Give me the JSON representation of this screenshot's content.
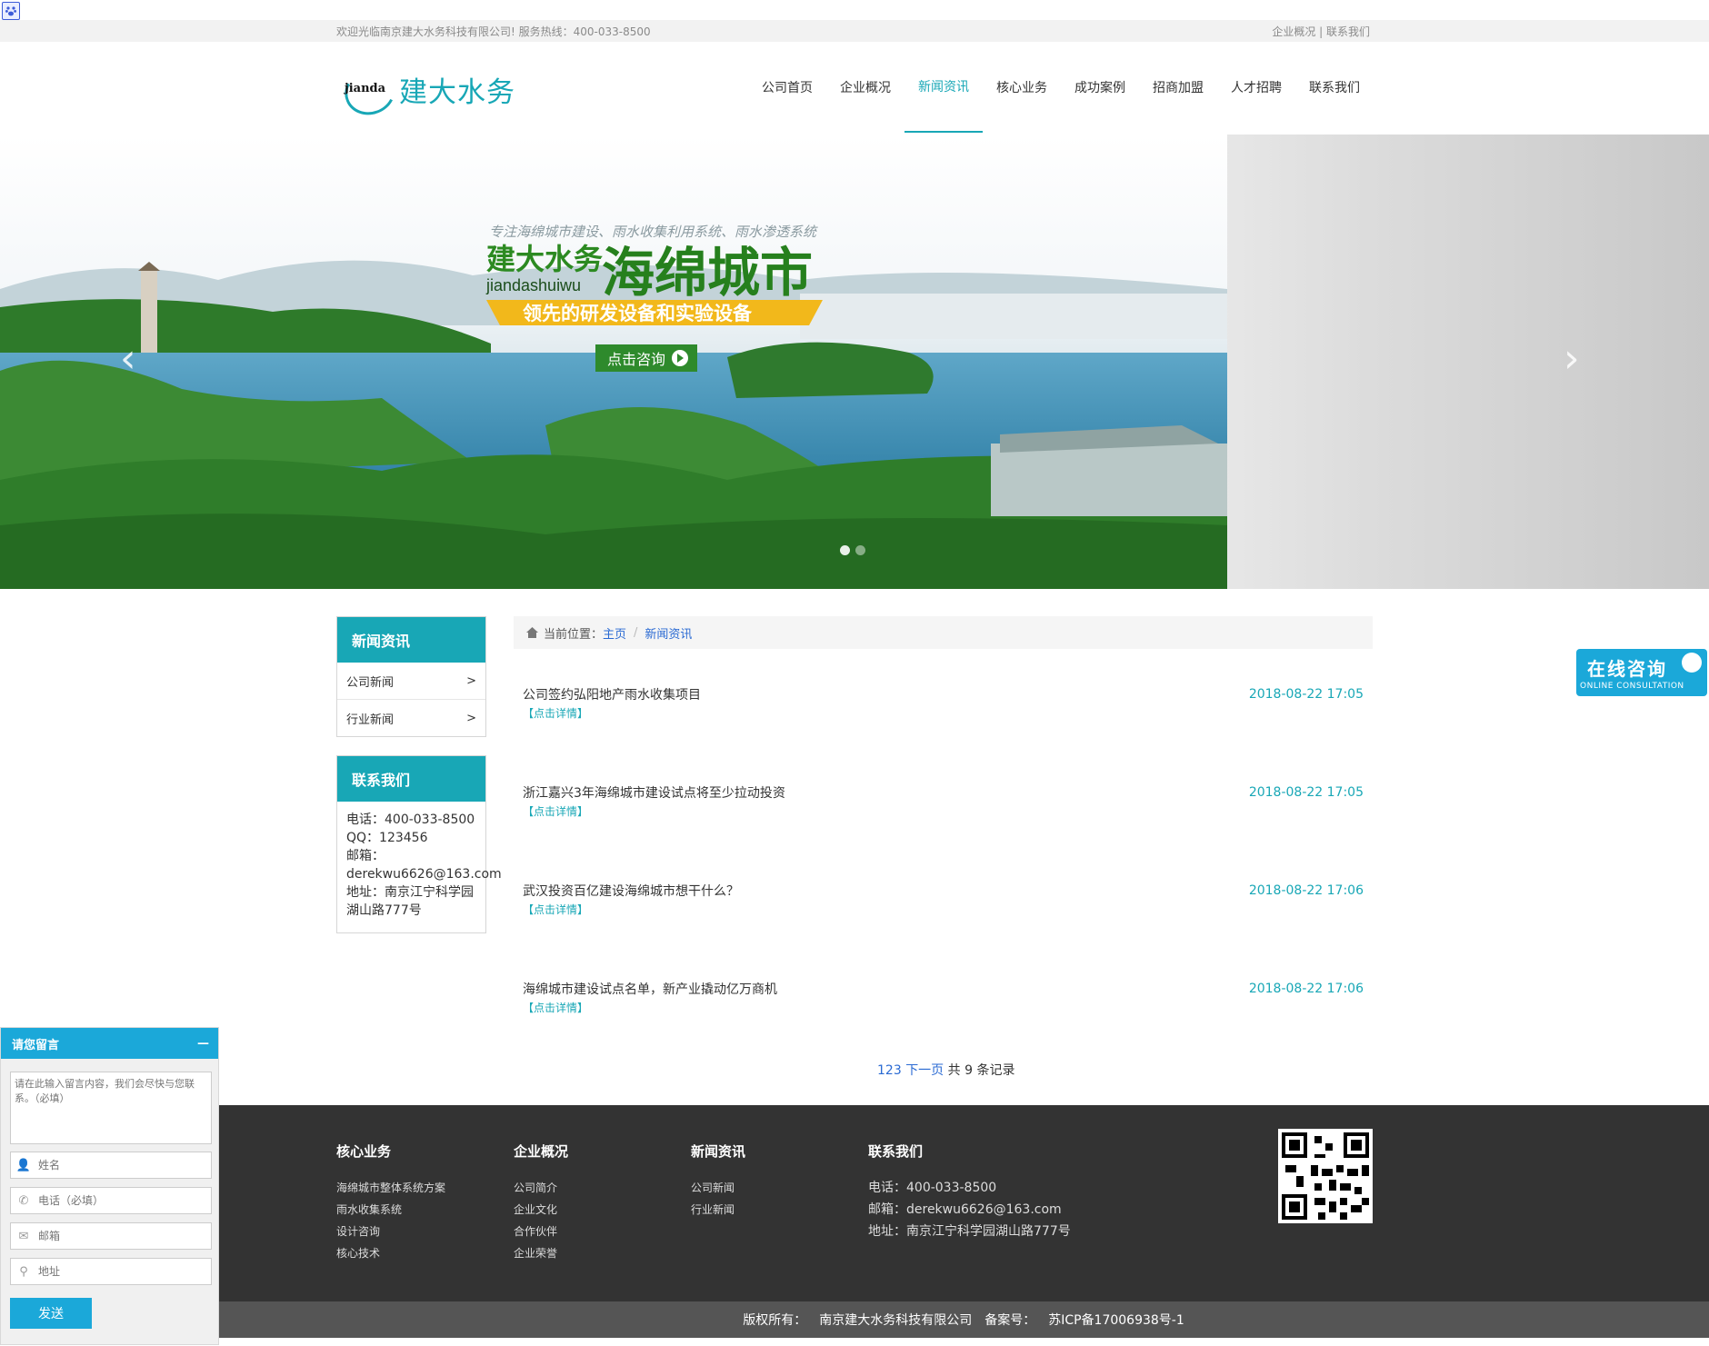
{
  "topbar": {
    "welcome": "欢迎光临南京建大水务科技有限公司!   服务热线：400-033-8500",
    "links": "企业概况 | 联系我们"
  },
  "logo": {
    "en": "jianda",
    "cn": "建大水务"
  },
  "nav": [
    "公司首页",
    "企业概况",
    "新闻资讯",
    "核心业务",
    "成功案例",
    "招商加盟",
    "人才招聘",
    "联系我们"
  ],
  "nav_active": 2,
  "banner": {
    "slogan": "专注海绵城市建设、雨水收集利用系统、雨水渗透系统",
    "brand_cn": "建大水务",
    "brand_en": "jiandashuiwu",
    "headline": "海绵城市",
    "ribbon": "领先的研发设备和实验设备",
    "cta": "点击咨询",
    "prev": "‹",
    "next": "›"
  },
  "sidebar": {
    "news_title": "新闻资讯",
    "news_items": [
      {
        "label": "公司新闻",
        "arrow": ">"
      },
      {
        "label": "行业新闻",
        "arrow": ">"
      }
    ],
    "contact_title": "联系我们",
    "contact_lines": [
      "电话：400-033-8500",
      "QQ：123456",
      "邮箱：",
      "derekwu6626@163.com",
      "地址：南京江宁科学园",
      "湖山路777号"
    ]
  },
  "breadcrumb": {
    "prefix": "当前位置：",
    "home": "主页",
    "sep": "/",
    "current": "新闻资讯"
  },
  "news": [
    {
      "title": "公司签约弘阳地产雨水收集项目",
      "more": "【点击详情】",
      "date": "2018-08-22 17:05"
    },
    {
      "title": "浙江嘉兴3年海绵城市建设试点将至少拉动投资",
      "more": "【点击详情】",
      "date": "2018-08-22 17:05"
    },
    {
      "title": "武汉投资百亿建设海绵城市想干什么？",
      "more": "【点击详情】",
      "date": "2018-08-22 17:06"
    },
    {
      "title": "海绵城市建设试点名单，新产业撬动亿万商机",
      "more": "【点击详情】",
      "date": "2018-08-22 17:06"
    }
  ],
  "pager": {
    "pages": "123",
    "next": "下一页",
    "total": " 共 9 条记录"
  },
  "footer": {
    "cols": [
      {
        "title": "核心业务",
        "items": [
          "海绵城市整体系统方案",
          "雨水收集系统",
          "设计咨询",
          "核心技术"
        ]
      },
      {
        "title": "企业概况",
        "items": [
          "公司简介",
          "企业文化",
          "合作伙伴",
          "企业荣誉"
        ]
      },
      {
        "title": "新闻资讯",
        "items": [
          "公司新闻",
          "行业新闻"
        ]
      },
      {
        "title": "联系我们",
        "items": [
          "电话：400-033-8500",
          "邮箱：derekwu6626@163.com",
          "地址：南京江宁科学园湖山路777号"
        ]
      }
    ],
    "copyright_label": "版权所有：",
    "company": "南京建大水务科技有限公司",
    "icp_label": "备案号：",
    "icp": "苏ICP备17006938号-1"
  },
  "message": {
    "title": "请您留言",
    "minimize": "—",
    "textarea_placeholder": "请在此输入留言内容，我们会尽快与您联系。（必填）",
    "name_placeholder": "姓名",
    "phone_placeholder": "电话（必填）",
    "email_placeholder": "邮箱",
    "address_placeholder": "地址",
    "send": "发送"
  },
  "online": {
    "zh": "在线咨询",
    "en": "ONLINE CONSULTATION"
  },
  "colors": {
    "accent": "#18a7b6",
    "chat_blue": "#1ba8d9",
    "footer_bg": "#333333",
    "copyright_bg": "#555555"
  }
}
